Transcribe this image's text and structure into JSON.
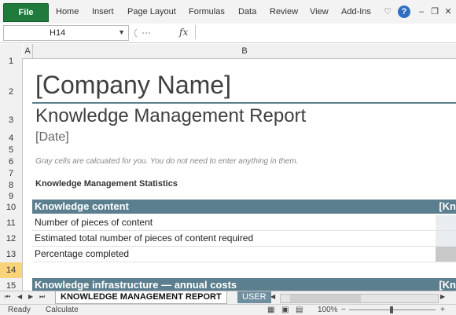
{
  "ribbon": {
    "file": "File",
    "tabs": [
      "Home",
      "Insert",
      "Page Layout",
      "Formulas",
      "Data",
      "Review",
      "View",
      "Add-Ins"
    ],
    "icons": [
      "heart-icon",
      "help-icon",
      "minimize-icon",
      "restore-icon",
      "close-icon"
    ]
  },
  "formula_bar": {
    "name_box": "H14",
    "fx": "fx",
    "value": ""
  },
  "columns": [
    "A",
    "B"
  ],
  "rows": [
    "1",
    "2",
    "3",
    "4",
    "5",
    "6",
    "7",
    "8",
    "9",
    "10",
    "11",
    "12",
    "13",
    "14",
    "15"
  ],
  "selected_row": "14",
  "sheet": {
    "company": "[Company Name]",
    "report": "Knowledge Management Report",
    "date": "[Date]",
    "hint": "Gray cells are calcuated for you. You do not need to enter anything in them.",
    "stats_title": "Knowledge Management Statistics",
    "section1": {
      "label": "Knowledge content",
      "right": "[Kn"
    },
    "rows": [
      "Number of pieces of content",
      "Estimated total number of pieces of content required",
      "Percentage completed"
    ],
    "section2": {
      "label": "Knowledge infrastructure — annual costs",
      "right": "[Kn"
    }
  },
  "tabs": {
    "active": "KNOWLEDGE MANAGEMENT REPORT",
    "other": "USER"
  },
  "status": {
    "ready": "Ready",
    "calculate": "Calculate",
    "zoom": "100%"
  },
  "colors": {
    "accent": "#5b7f8e",
    "file_tab": "#1f7a3c",
    "selected_row": "#f8d37a"
  }
}
